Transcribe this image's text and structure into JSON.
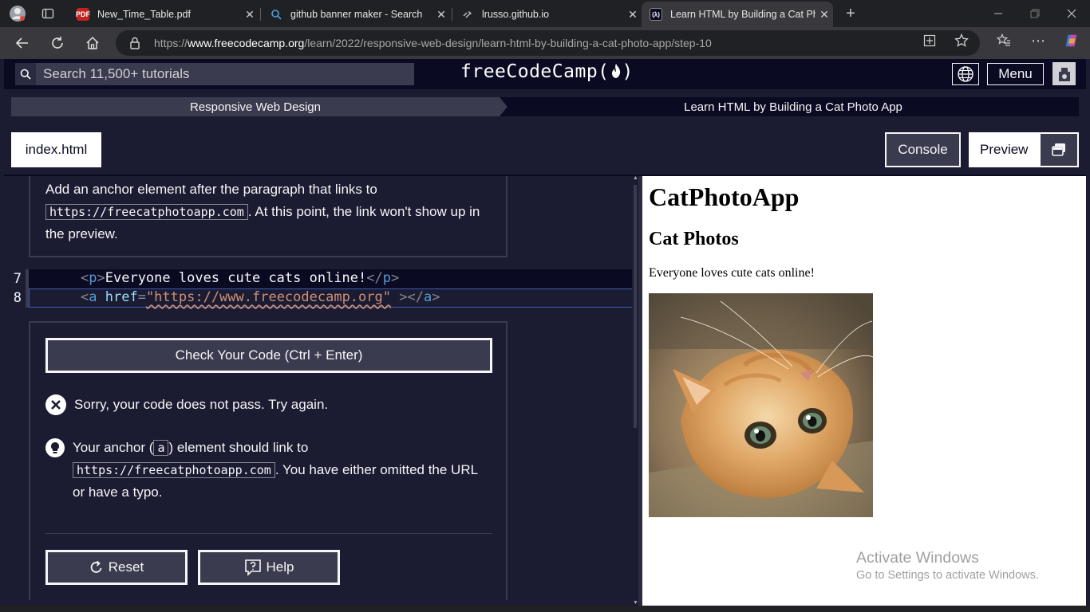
{
  "browser": {
    "tabs": [
      {
        "title": "New_Time_Table.pdf",
        "favicon": "pdf-icon"
      },
      {
        "title": "github banner maker - Search",
        "favicon": "search-icon"
      },
      {
        "title": "lrusso.github.io",
        "favicon": "page-icon"
      },
      {
        "title": "Learn HTML by Building a Cat Pho",
        "favicon": "fcc-icon",
        "active": true
      }
    ],
    "url_prefix": "https://",
    "url_domain": "www.freecodecamp.org",
    "url_path": "/learn/2022/responsive-web-design/learn-html-by-building-a-cat-photo-app/step-10"
  },
  "header": {
    "search_placeholder": "Search 11,500+ tutorials",
    "logo": "freeCodeCamp(",
    "logo_end": ")",
    "menu_label": "Menu"
  },
  "breadcrumb": {
    "course": "Responsive Web Design",
    "project": "Learn HTML by Building a Cat Photo App"
  },
  "toolbar": {
    "file_tab": "index.html",
    "console_label": "Console",
    "preview_label": "Preview"
  },
  "instructions": {
    "text_before": "Add an anchor element after the paragraph that links to ",
    "code": "https://freecatphotoapp.com",
    "text_after": ". At this point, the link won't show up in the preview."
  },
  "editor": {
    "lines": [
      {
        "number": "7"
      },
      {
        "number": "8"
      }
    ],
    "line7": {
      "open": "<",
      "tag": "p",
      "close": ">",
      "text": "Everyone loves cute cats online!",
      "end_open": "</",
      "end_tag": "p",
      "end_close": ">"
    },
    "line8": {
      "open": "<",
      "tag": "a",
      "attr": " href",
      "eq": "=",
      "str": "\"https://www.freecodecamp.org\"",
      "gap": " ",
      "close": ">",
      "end_open": "</",
      "end_tag": "a",
      "end_close": ">"
    }
  },
  "lower": {
    "check_button": "Check Your Code (Ctrl + Enter)",
    "fail_message": "Sorry, your code does not pass. Try again.",
    "hint_before": "Your anchor (",
    "hint_code1": "a",
    "hint_mid": ") element should link to",
    "hint_code2": "https://freecatphotoapp.com",
    "hint_after": ". You have either omitted the URL or have a typo.",
    "reset_label": "Reset",
    "help_label": "Help"
  },
  "preview": {
    "h1": "CatPhotoApp",
    "h2": "Cat Photos",
    "paragraph": "Everyone loves cute cats online!"
  },
  "watermark": {
    "line1": "Activate Windows",
    "line2": "Go to Settings to activate Windows."
  },
  "colors": {
    "fcc_dark": "#0a0a23",
    "fcc_bg": "#1b1b32",
    "fcc_gray": "#3b3b4f",
    "fcc_text": "#f5f6f7"
  }
}
